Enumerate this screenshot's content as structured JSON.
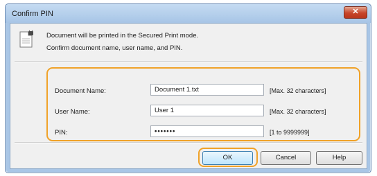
{
  "window": {
    "title": "Confirm PIN",
    "close_glyph": "✕"
  },
  "message": {
    "line1": "Document will be printed in the Secured Print mode.",
    "line2": "Confirm document name, user name, and PIN.",
    "icon": "secure-print-document-icon"
  },
  "form": {
    "document_name": {
      "label": "Document Name:",
      "value": "Document 1.txt",
      "hint": "[Max. 32 characters]"
    },
    "user_name": {
      "label": "User Name:",
      "value": "User 1",
      "hint": "[Max. 32 characters]"
    },
    "pin": {
      "label": "PIN:",
      "value": "•••••••",
      "hint": "[1 to 9999999]"
    }
  },
  "buttons": {
    "ok": "OK",
    "cancel": "Cancel",
    "help": "Help"
  },
  "colors": {
    "highlight": "#f0a228",
    "frame": "#a9c6e6",
    "close": "#c8452a"
  }
}
